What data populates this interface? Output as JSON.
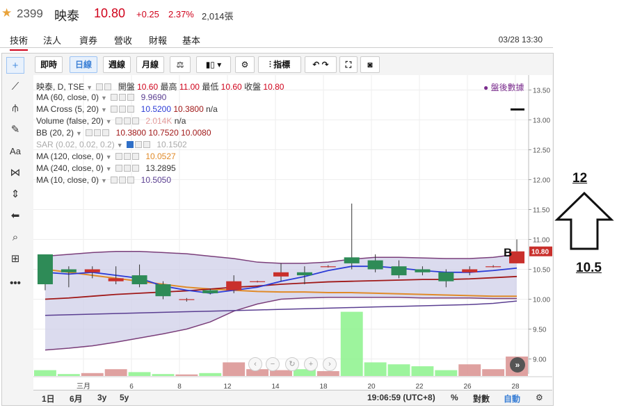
{
  "header": {
    "star_icon": "star-icon",
    "code": "2399",
    "name": "映泰",
    "price": "10.80",
    "change": "+0.25",
    "change_pct": "2.37%",
    "volume": "2,014張"
  },
  "main_tabs": [
    {
      "label": "技術"
    },
    {
      "label": "法人"
    },
    {
      "label": "資券"
    },
    {
      "label": "營收"
    },
    {
      "label": "財報"
    },
    {
      "label": "基本"
    }
  ],
  "timestamp": "03/28 13:30",
  "toolbar": {
    "intraday": "即時",
    "daily": "日線",
    "weekly": "週線",
    "monthly": "月線",
    "indicators": "指標"
  },
  "legend": {
    "main": {
      "name": "映泰, D, TSE",
      "open_label": "開盤",
      "open": "10.60",
      "high_label": "最高",
      "high": "11.00",
      "low_label": "最低",
      "low": "10.60",
      "close_label": "收盤",
      "close": "10.80"
    },
    "rows": [
      {
        "name": "MA (60, close, 0)",
        "values": [
          "9.9690"
        ]
      },
      {
        "name": "MA Cross (5, 20)",
        "values": [
          "10.5200",
          "10.3800",
          "n/a"
        ]
      },
      {
        "name": "Volume (false, 20)",
        "values": [
          "2.014K",
          "n/a"
        ]
      },
      {
        "name": "BB (20, 2)",
        "values": [
          "10.3800",
          "10.7520",
          "10.0080"
        ]
      },
      {
        "name": "SAR (0.02, 0.02, 0.2)",
        "values": [
          "10.1502"
        ]
      },
      {
        "name": "MA (120, close, 0)",
        "values": [
          "10.0527"
        ]
      },
      {
        "name": "MA (240, close, 0)",
        "values": [
          "13.2895"
        ]
      },
      {
        "name": "MA (10, close, 0)",
        "values": [
          "10.5050"
        ]
      }
    ]
  },
  "after_hours": "盤後數據",
  "bottom_bar": {
    "range_1d": "1日",
    "range_6m": "6月",
    "range_3y": "3y",
    "range_5y": "5y",
    "clock": "19:06:59 (UTC+8)",
    "percent": "%",
    "log": "對數",
    "auto": "自動"
  },
  "price_tag": "10.80",
  "marker_label": "B",
  "annotation": {
    "high": "12",
    "low": "10.5"
  },
  "colors": {
    "up": "#c9302c",
    "down": "#2e8b57",
    "ma_blue": "#2b3bd6",
    "ma_red": "#a01818",
    "ma_orange": "#e08a28",
    "ma_purple": "#5a3e91",
    "bb_fill": "#cfcfe8"
  },
  "chart_data": {
    "type": "candlestick",
    "price_axis": {
      "ticks": [
        9.0,
        9.5,
        10.0,
        10.5,
        11.0,
        11.5,
        12.0,
        12.5,
        13.0,
        13.5
      ],
      "ylim": [
        8.75,
        13.75
      ]
    },
    "x_ticks": [
      "三月",
      "6",
      "8",
      "12",
      "14",
      "18",
      "20",
      "22",
      "26",
      "28"
    ],
    "candles": [
      {
        "o": 10.75,
        "h": 10.75,
        "l": 10.15,
        "c": 10.25
      },
      {
        "o": 10.5,
        "h": 10.55,
        "l": 10.2,
        "c": 10.45
      },
      {
        "o": 10.45,
        "h": 10.55,
        "l": 10.35,
        "c": 10.5
      },
      {
        "o": 10.3,
        "h": 10.55,
        "l": 10.25,
        "c": 10.35
      },
      {
        "o": 10.4,
        "h": 10.58,
        "l": 10.2,
        "c": 10.25
      },
      {
        "o": 10.25,
        "h": 10.3,
        "l": 10.0,
        "c": 10.05
      },
      {
        "o": 10.0,
        "h": 10.02,
        "l": 9.96,
        "c": 10.0
      },
      {
        "o": 10.15,
        "h": 10.18,
        "l": 10.08,
        "c": 10.1
      },
      {
        "o": 10.15,
        "h": 10.4,
        "l": 10.1,
        "c": 10.3
      },
      {
        "o": 10.3,
        "h": 10.31,
        "l": 10.28,
        "c": 10.3
      },
      {
        "o": 10.38,
        "h": 10.6,
        "l": 10.3,
        "c": 10.45
      },
      {
        "o": 10.45,
        "h": 10.55,
        "l": 10.25,
        "c": 10.4
      },
      {
        "o": 10.55,
        "h": 10.57,
        "l": 10.53,
        "c": 10.55
      },
      {
        "o": 10.7,
        "h": 11.6,
        "l": 10.5,
        "c": 10.6
      },
      {
        "o": 10.65,
        "h": 10.75,
        "l": 10.45,
        "c": 10.5
      },
      {
        "o": 10.55,
        "h": 10.65,
        "l": 10.35,
        "c": 10.4
      },
      {
        "o": 10.5,
        "h": 10.55,
        "l": 10.4,
        "c": 10.45
      },
      {
        "o": 10.45,
        "h": 10.5,
        "l": 10.2,
        "c": 10.3
      },
      {
        "o": 10.45,
        "h": 10.55,
        "l": 10.4,
        "c": 10.5
      },
      {
        "o": 10.55,
        "h": 10.57,
        "l": 10.53,
        "c": 10.55
      },
      {
        "o": 10.6,
        "h": 11.0,
        "l": 10.6,
        "c": 10.8
      }
    ],
    "volume": [
      0.3,
      0.1,
      0.15,
      0.35,
      0.2,
      0.1,
      0.08,
      0.15,
      0.7,
      0.35,
      0.3,
      0.35,
      0.25,
      3.3,
      0.7,
      0.6,
      0.5,
      0.3,
      0.6,
      0.35,
      1.0
    ],
    "ma_blue": [
      10.45,
      10.42,
      10.45,
      10.4,
      10.35,
      10.22,
      10.15,
      10.1,
      10.15,
      10.2,
      10.3,
      10.38,
      10.48,
      10.55,
      10.55,
      10.52,
      10.48,
      10.45,
      10.45,
      10.48,
      10.52
    ],
    "ma_red": [
      10.0,
      10.02,
      10.05,
      10.08,
      10.1,
      10.12,
      10.14,
      10.17,
      10.2,
      10.22,
      10.25,
      10.27,
      10.29,
      10.3,
      10.31,
      10.32,
      10.33,
      10.33,
      10.34,
      10.36,
      10.38
    ],
    "ma_orange": [
      10.5,
      10.45,
      10.4,
      10.35,
      10.3,
      10.25,
      10.2,
      10.17,
      10.15,
      10.13,
      10.12,
      10.12,
      10.11,
      10.11,
      10.1,
      10.09,
      10.08,
      10.07,
      10.06,
      10.05,
      10.05
    ],
    "ma_purple": [
      9.73,
      9.74,
      9.75,
      9.76,
      9.77,
      9.78,
      9.79,
      9.8,
      9.81,
      9.82,
      9.83,
      9.84,
      9.85,
      9.86,
      9.87,
      9.88,
      9.89,
      9.9,
      9.91,
      9.93,
      9.97
    ],
    "bb_upper": [
      10.72,
      10.75,
      10.78,
      10.8,
      10.8,
      10.78,
      10.76,
      10.72,
      10.68,
      10.62,
      10.6,
      10.6,
      10.62,
      10.67,
      10.7,
      10.7,
      10.69,
      10.68,
      10.68,
      10.7,
      10.75
    ],
    "bb_lower": [
      9.15,
      9.18,
      9.22,
      9.28,
      9.35,
      9.42,
      9.5,
      9.62,
      9.8,
      9.92,
      10.0,
      10.02,
      10.03,
      10.03,
      10.03,
      10.03,
      10.02,
      10.02,
      10.02,
      10.01,
      10.01
    ]
  }
}
